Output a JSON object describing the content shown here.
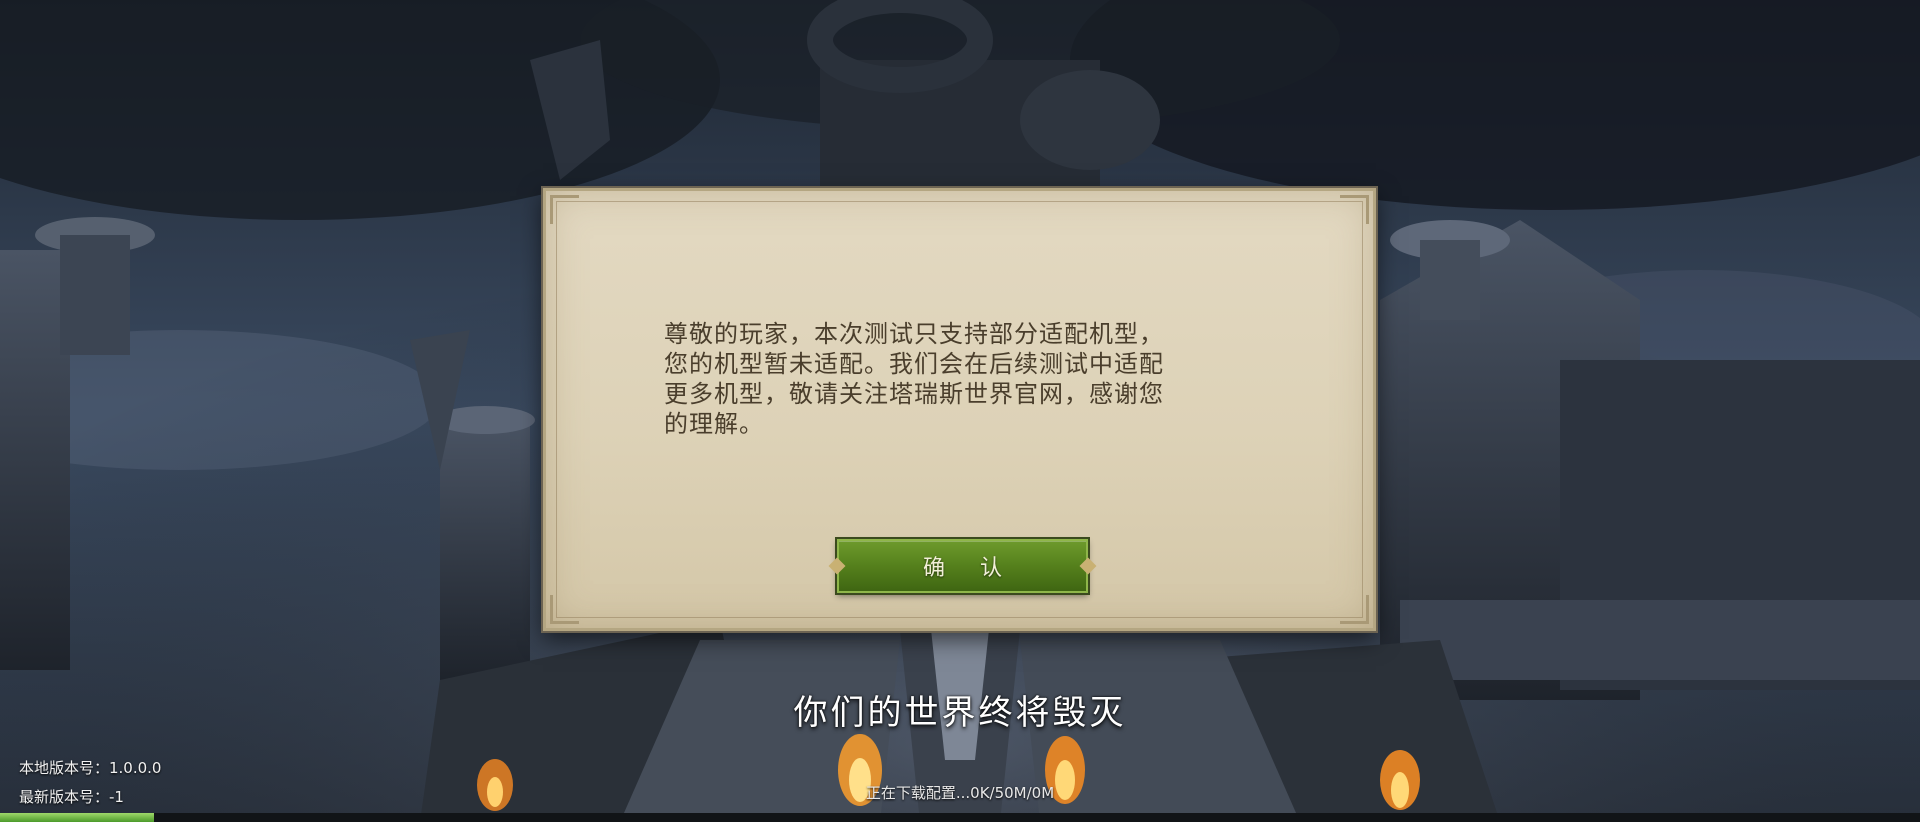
{
  "dialog": {
    "message_lines": [
      "尊敬的玩家，本次测试只支持部分适配机型，",
      "您的机型暂未适配。我们会在后续测试中适配",
      "更多机型，敬请关注塔瑞斯世界官网，感谢您",
      "的理解。"
    ],
    "confirm_label": "确 认"
  },
  "subtitle": "你们的世界终将毁灭",
  "version": {
    "local": "本地版本号：1.0.0.0",
    "latest": "最新版本号：-1"
  },
  "download": {
    "status": "正在下载配置...0K/50M/0M",
    "progress": 0.08
  },
  "colors": {
    "confirm_green": "#55801c",
    "parchment": "#ddd2b7",
    "progress_green": "#7cc24a"
  }
}
